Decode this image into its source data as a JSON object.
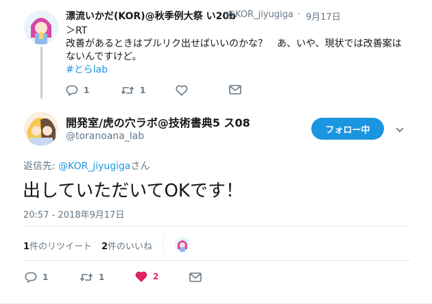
{
  "parent_tweet": {
    "display_name": "漂流いかだ(KOR)@秋季例大祭 い20b",
    "handle": "@KOR_jiyugiga",
    "sep": "·",
    "date": "9月17日",
    "text_line1": "＞RT",
    "text_line2": "改善があるときはプルリク出せばいいのかな？　あ、いや、現状では改善案は",
    "text_line3": "ないんですけど。",
    "hashtag": "#とらlab",
    "actions": {
      "replies": "1",
      "retweets": "1"
    }
  },
  "main_tweet": {
    "display_name": "開発室/虎の穴ラボ@技術書典5 ス08",
    "handle": "@toranoana_lab",
    "follow_label": "フォロー中",
    "reply_prefix": "返信先: ",
    "reply_to": "@KOR_jiyugiga",
    "reply_suffix": "さん",
    "body": "出していただいてOKです！",
    "timestamp": "20:57 - 2018年9月17日",
    "stats": {
      "retweets_count": "1",
      "retweets_label": "件のリツイート",
      "likes_count": "2",
      "likes_label": "件のいいね"
    },
    "actions": {
      "replies": "1",
      "retweets": "1",
      "likes": "2"
    }
  },
  "colors": {
    "accent": "#1b95e0",
    "like": "#e0245e",
    "muted": "#657786"
  }
}
